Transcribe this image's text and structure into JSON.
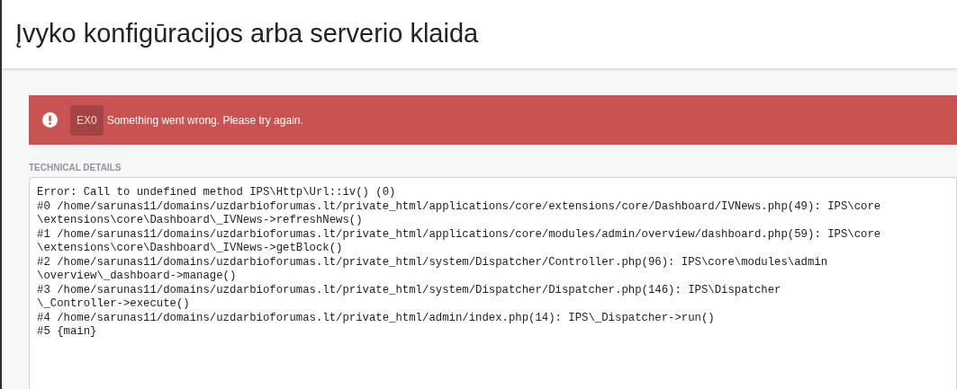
{
  "title": "Įvyko konfigūracijos arba serverio klaida",
  "alert": {
    "code": "EX0",
    "message": "Something went wrong. Please try again."
  },
  "technical_details": {
    "heading": "TECHNICAL DETAILS",
    "lines": [
      "Error: Call to undefined method IPS\\Http\\Url::iv() (0)",
      "#0 /home/sarunas11/domains/uzdarbioforumas.lt/private_html/applications/core/extensions/core/Dashboard/IVNews.php(49): IPS\\core",
      "\\extensions\\core\\Dashboard\\_IVNews->refreshNews()",
      "#1 /home/sarunas11/domains/uzdarbioforumas.lt/private_html/applications/core/modules/admin/overview/dashboard.php(59): IPS\\core",
      "\\extensions\\core\\Dashboard\\_IVNews->getBlock()",
      "#2 /home/sarunas11/domains/uzdarbioforumas.lt/private_html/system/Dispatcher/Controller.php(96): IPS\\core\\modules\\admin",
      "\\overview\\_dashboard->manage()",
      "#3 /home/sarunas11/domains/uzdarbioforumas.lt/private_html/system/Dispatcher/Dispatcher.php(146): IPS\\Dispatcher",
      "\\_Controller->execute()",
      "#4 /home/sarunas11/domains/uzdarbioforumas.lt/private_html/admin/index.php(14): IPS\\_Dispatcher->run()",
      "#5 {main}"
    ]
  }
}
